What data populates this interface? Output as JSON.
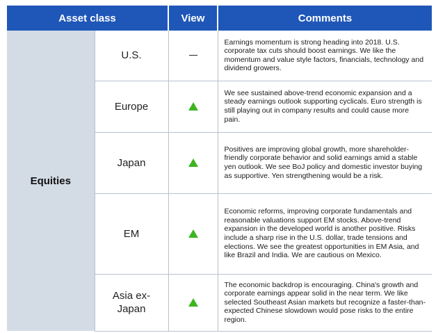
{
  "header": {
    "asset_class": "Asset class",
    "view": "View",
    "comments": "Comments"
  },
  "group_label": "Equities",
  "rows": [
    {
      "region": "U.S.",
      "view_icon": "neutral-dash-icon",
      "comment": "Earnings momentum is strong heading into 2018. U.S. corporate tax cuts should boost earnings. We like the momentum and value style factors, financials, technology and dividend growers."
    },
    {
      "region": "Europe",
      "view_icon": "green-up-triangle-icon",
      "comment": "We see sustained above-trend economic expansion and a steady earnings outlook supporting cyclicals. Euro strength is still playing out in company results and could cause more pain."
    },
    {
      "region": "Japan",
      "view_icon": "green-up-triangle-icon",
      "comment": "Positives are improving global growth, more shareholder-friendly corporate behavior and solid earnings amid a stable yen outlook. We see BoJ policy and domestic investor buying as supportive. Yen strengthening would be a risk."
    },
    {
      "region": "EM",
      "view_icon": "green-up-triangle-icon",
      "comment": "Economic reforms, improving corporate fundamentals and reasonable valuations support EM stocks. Above-trend expansion in the developed world is another positive. Risks include a sharp rise in the U.S. dollar, trade tensions and elections. We see the greatest opportunities in EM Asia, and like Brazil and India. We are cautious on Mexico."
    },
    {
      "region": "Asia ex-Japan",
      "view_icon": "green-up-triangle-icon",
      "comment": "The economic backdrop is encouraging. China's growth and corporate earnings appear solid in the near term. We like selected Southeast Asian markets but recognize a faster-than-expected Chinese slowdown would pose risks to the entire region."
    }
  ],
  "colors": {
    "header_bg": "#1f57b8",
    "group_bg": "#d3dbe5",
    "up_arrow": "#3cb521"
  }
}
